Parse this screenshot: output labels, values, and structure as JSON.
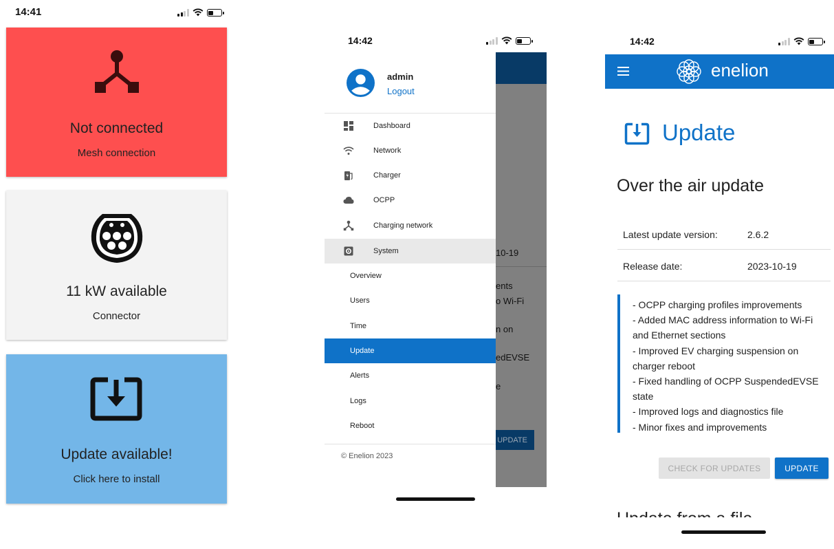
{
  "screen1": {
    "time": "14:41",
    "mesh_card": {
      "title": "Not connected",
      "subtitle": "Mesh connection",
      "color": "#fe4f4f",
      "icon": "mesh-network-icon"
    },
    "connector_card": {
      "title": "11 kW available",
      "subtitle": "Connector",
      "color": "#f3f3f3",
      "icon": "type2-connector-icon"
    },
    "update_card": {
      "title": "Update available!",
      "subtitle": "Click here to install",
      "color": "#73b6e8",
      "icon": "download-icon"
    }
  },
  "screen2": {
    "time": "14:42",
    "user": {
      "name": "admin",
      "logout_label": "Logout",
      "icon": "account-circle-icon"
    },
    "menu": [
      {
        "label": "Dashboard",
        "icon": "dashboard-icon"
      },
      {
        "label": "Network",
        "icon": "wifi-icon"
      },
      {
        "label": "Charger",
        "icon": "charger-icon"
      },
      {
        "label": "OCPP",
        "icon": "cloud-icon"
      },
      {
        "label": "Charging network",
        "icon": "mesh-network-icon"
      },
      {
        "label": "System",
        "icon": "gear-icon"
      }
    ],
    "system_submenu": [
      "Overview",
      "Users",
      "Time",
      "Update",
      "Alerts",
      "Logs",
      "Reboot"
    ],
    "active_item": "Update",
    "footer": "© Enelion 2023",
    "background_fragments": [
      "10-19",
      "ents",
      "o Wi-Fi",
      "n on",
      "edEVSE",
      "e",
      "UPDATE"
    ]
  },
  "screen3": {
    "time": "14:42",
    "brand": "enelion",
    "page_title": "Update",
    "section_title": "Over the air update",
    "info_rows": [
      {
        "label": "Latest update version:",
        "value": "2.6.2"
      },
      {
        "label": "Release date:",
        "value": "2023-10-19"
      }
    ],
    "release_notes": [
      "- OCPP charging profiles improvements",
      "- Added MAC address information to Wi-Fi and Ethernet sections",
      "- Improved EV charging suspension on charger reboot",
      "- Fixed handling of OCPP SuspendedEVSE state",
      "- Improved logs and diagnostics file",
      "- Minor fixes and improvements"
    ],
    "check_button": "CHECK FOR UPDATES",
    "update_button": "UPDATE",
    "next_section": "Update from a file",
    "accent": "#0f72c8"
  }
}
